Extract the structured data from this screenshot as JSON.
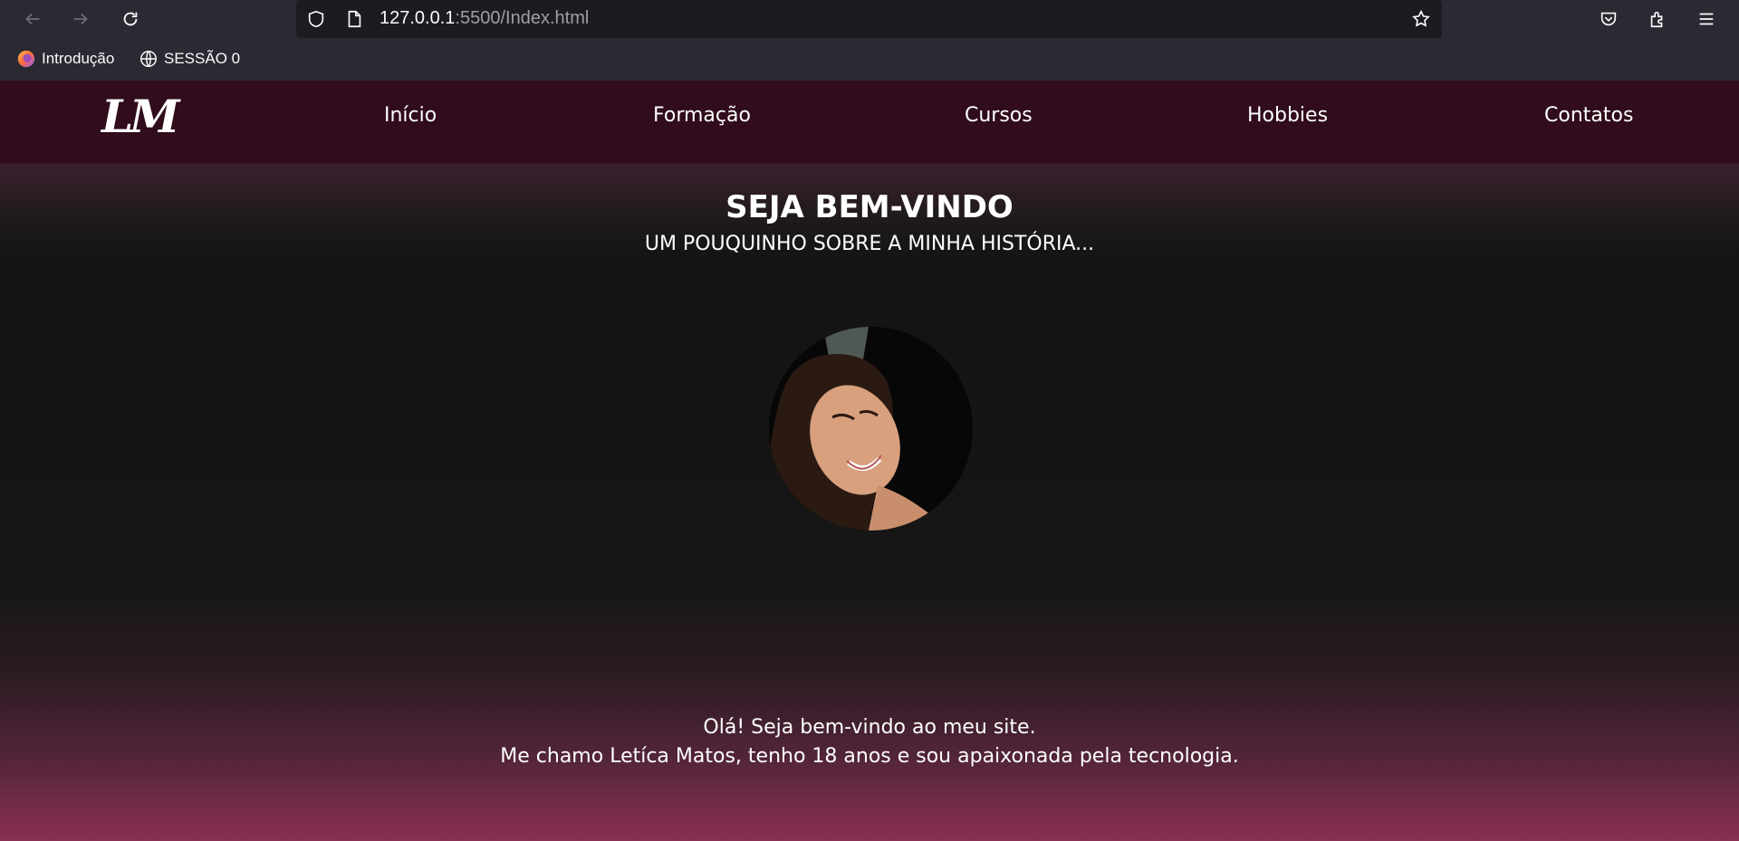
{
  "browser": {
    "url_host": "127.0.0.1",
    "url_path": ":5500/Index.html",
    "icons": [
      "back-icon",
      "forward-icon",
      "reload-icon",
      "shield-icon",
      "page-icon",
      "star-icon",
      "pocket-icon",
      "extensions-icon",
      "menu-icon"
    ]
  },
  "bookmarks": [
    {
      "label": "Introdução",
      "icon": "firefox-icon"
    },
    {
      "label": "SESSÃO 0",
      "icon": "globe-icon"
    }
  ],
  "site": {
    "logo": "LM",
    "nav": [
      "Início",
      "Formação",
      "Cursos",
      "Hobbies",
      "Contatos"
    ],
    "hero": {
      "title": "SEJA BEM-VINDO",
      "subtitle": "UM POUQUINHO SOBRE A MINHA HISTÓRIA..."
    },
    "intro": {
      "line1": "Olá! Seja bem-vindo ao meu site.",
      "line2": "Me chamo Letíca Matos, tenho 18 anos e sou apaixonada pela tecnologia."
    }
  },
  "colors": {
    "navbar": "#300c1c",
    "gradient_top": "#6a2b47",
    "gradient_mid": "#161616",
    "gradient_bottom": "#8a2f52"
  }
}
